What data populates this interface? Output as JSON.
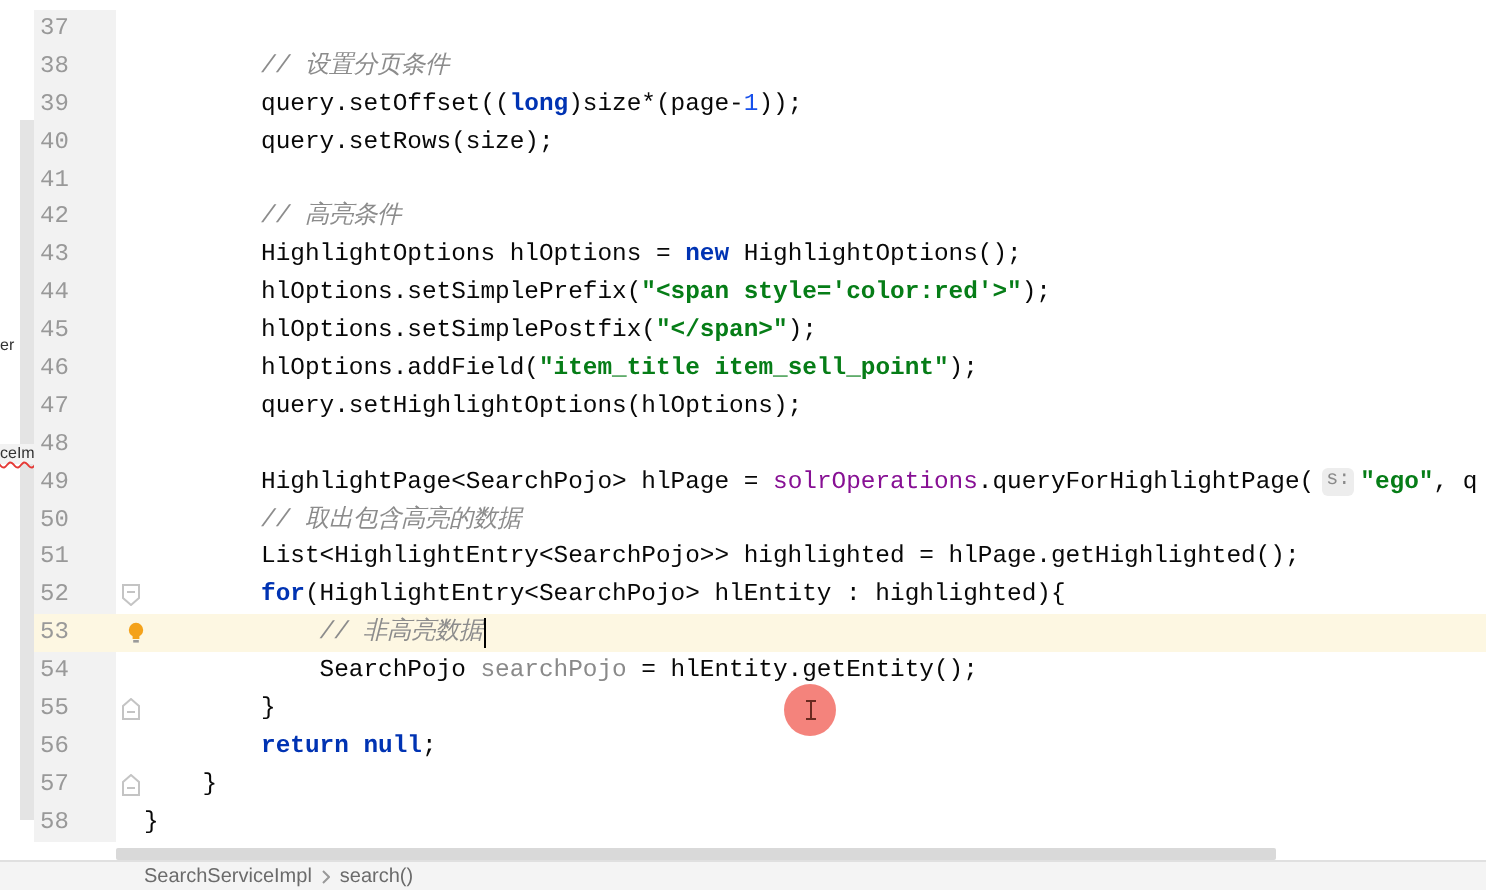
{
  "side_panel": {
    "items": [
      {
        "text": "er",
        "error": false
      },
      {
        "text": "ceIm",
        "error": true
      }
    ]
  },
  "editor": {
    "lines": [
      {
        "number": "37"
      },
      {
        "number": "38",
        "tokens": [
          {
            "kind": "cmt",
            "text": "        // 设置分页条件"
          }
        ]
      },
      {
        "number": "39",
        "tokens": [
          {
            "kind": "plain",
            "text": "        query.setOffset(("
          },
          {
            "kind": "kw",
            "text": "long"
          },
          {
            "kind": "plain",
            "text": ")size*(page-"
          },
          {
            "kind": "num",
            "text": "1"
          },
          {
            "kind": "plain",
            "text": "));"
          }
        ]
      },
      {
        "number": "40",
        "tokens": [
          {
            "kind": "plain",
            "text": "        query.setRows(size);"
          }
        ]
      },
      {
        "number": "41"
      },
      {
        "number": "42",
        "tokens": [
          {
            "kind": "cmt",
            "text": "        // 高亮条件"
          }
        ]
      },
      {
        "number": "43",
        "tokens": [
          {
            "kind": "plain",
            "text": "        HighlightOptions hlOptions = "
          },
          {
            "kind": "kw",
            "text": "new"
          },
          {
            "kind": "plain",
            "text": " HighlightOptions();"
          }
        ]
      },
      {
        "number": "44",
        "tokens": [
          {
            "kind": "plain",
            "text": "        hlOptions.setSimplePrefix("
          },
          {
            "kind": "str",
            "text": "\"<span style='color:red'>\""
          },
          {
            "kind": "plain",
            "text": ");"
          }
        ]
      },
      {
        "number": "45",
        "tokens": [
          {
            "kind": "plain",
            "text": "        hlOptions.setSimplePostfix("
          },
          {
            "kind": "str",
            "text": "\"</span>\""
          },
          {
            "kind": "plain",
            "text": ");"
          }
        ]
      },
      {
        "number": "46",
        "tokens": [
          {
            "kind": "plain",
            "text": "        hlOptions.addField("
          },
          {
            "kind": "str",
            "text": "\"item_title item_sell_point\""
          },
          {
            "kind": "plain",
            "text": ");"
          }
        ]
      },
      {
        "number": "47",
        "tokens": [
          {
            "kind": "plain",
            "text": "        query.setHighlightOptions(hlOptions);"
          }
        ]
      },
      {
        "number": "48"
      },
      {
        "number": "49",
        "tokens": [
          {
            "kind": "plain",
            "text": "        HighlightPage<SearchPojo> hlPage = "
          },
          {
            "kind": "field",
            "text": "solrOperations"
          },
          {
            "kind": "plain",
            "text": ".queryForHighlightPage("
          },
          {
            "kind": "hint",
            "text": "s:"
          },
          {
            "kind": "str",
            "text": "\"ego\""
          },
          {
            "kind": "plain",
            "text": ", q"
          }
        ]
      },
      {
        "number": "50",
        "tokens": [
          {
            "kind": "cmt",
            "text": "        // 取出包含高亮的数据"
          }
        ]
      },
      {
        "number": "51",
        "tokens": [
          {
            "kind": "plain",
            "text": "        List<HighlightEntry<SearchPojo>> highlighted = hlPage.getHighlighted();"
          }
        ]
      },
      {
        "number": "52",
        "fold_start": true,
        "tokens": [
          {
            "kind": "kw",
            "text": "        for"
          },
          {
            "kind": "plain",
            "text": "(HighlightEntry<SearchPojo> hlEntity : highlighted){"
          }
        ]
      },
      {
        "number": "53",
        "current": true,
        "bulb": true,
        "caret": true,
        "tokens": [
          {
            "kind": "cmt",
            "text": "            // 非高亮数据"
          }
        ]
      },
      {
        "number": "54",
        "tokens": [
          {
            "kind": "plain",
            "text": "            SearchPojo "
          },
          {
            "kind": "unused",
            "text": "searchPojo"
          },
          {
            "kind": "plain",
            "text": " = hlEntity.getEntity();"
          }
        ]
      },
      {
        "number": "55",
        "fold_end": true,
        "tokens": [
          {
            "kind": "plain",
            "text": "        }"
          }
        ]
      },
      {
        "number": "56",
        "tokens": [
          {
            "kind": "kw",
            "text": "        return null"
          },
          {
            "kind": "plain",
            "text": ";"
          }
        ]
      },
      {
        "number": "57",
        "fold_end": true,
        "tokens": [
          {
            "kind": "plain",
            "text": "    }"
          }
        ]
      },
      {
        "number": "58",
        "tokens": [
          {
            "kind": "plain",
            "text": "}"
          }
        ]
      }
    ]
  },
  "breadcrumb": [
    "SearchServiceImpl",
    "search()"
  ]
}
